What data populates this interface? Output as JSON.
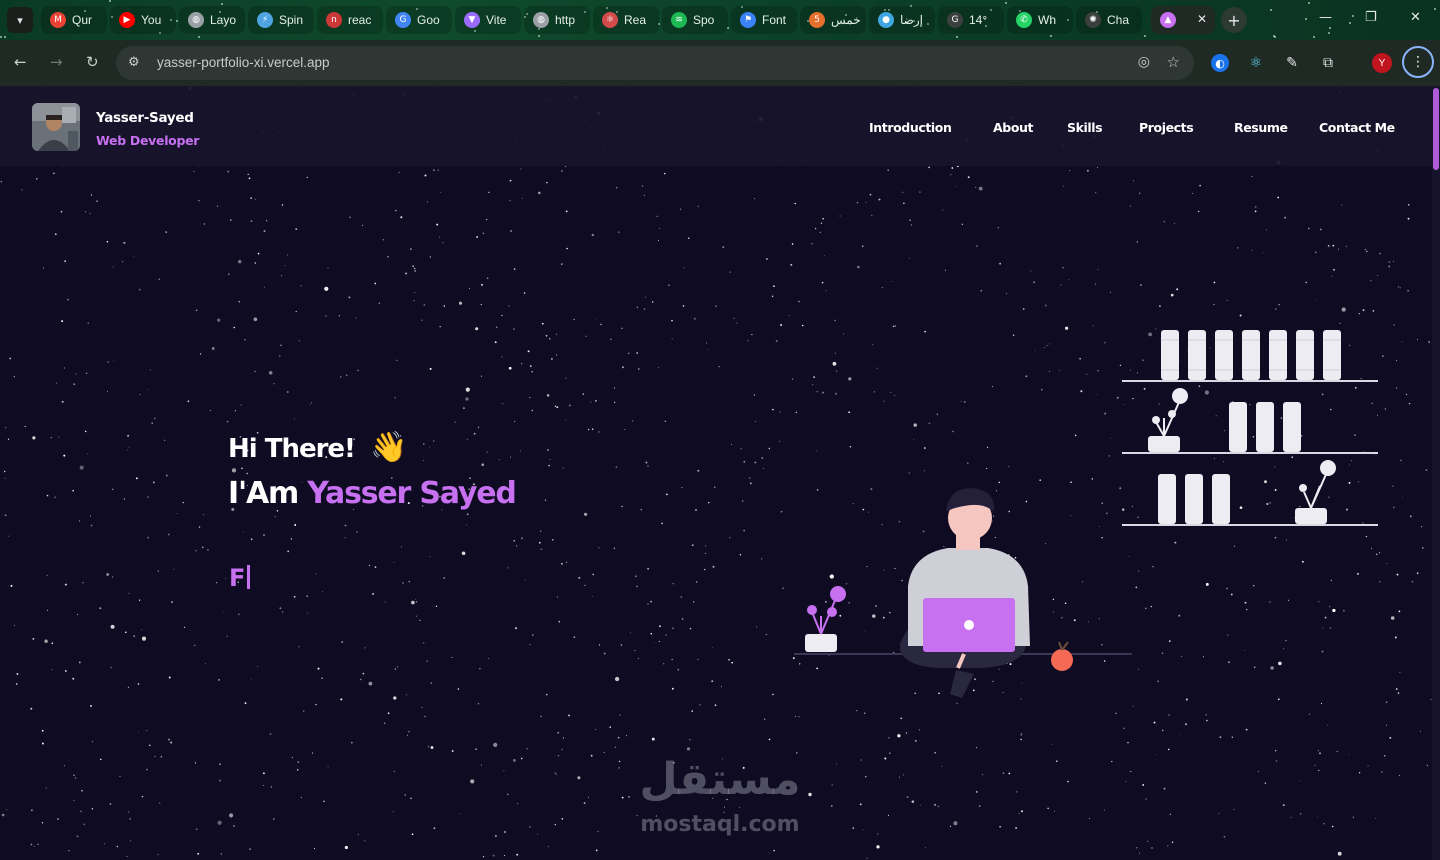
{
  "browser": {
    "tabs": [
      {
        "title": "Qur",
        "icon": "gmail-icon",
        "color": "#ea4335"
      },
      {
        "title": "You",
        "icon": "youtube-icon",
        "color": "#ff0000"
      },
      {
        "title": "Layo",
        "icon": "globe-icon",
        "color": "#9aa0a6"
      },
      {
        "title": "Spin",
        "icon": "spin-icon",
        "color": "#4fa3e0"
      },
      {
        "title": "reac",
        "icon": "npm-icon",
        "color": "#cb3837"
      },
      {
        "title": "Goo",
        "icon": "translate-icon",
        "color": "#4285f4"
      },
      {
        "title": "Vite",
        "icon": "vite-icon",
        "color": "#9b6bff"
      },
      {
        "title": "http",
        "icon": "globe-icon",
        "color": "#9aa0a6"
      },
      {
        "title": "Rea",
        "icon": "react-icon",
        "color": "#d34a4a"
      },
      {
        "title": "Spo",
        "icon": "spotify-icon",
        "color": "#1db954"
      },
      {
        "title": "Font",
        "icon": "flag-icon",
        "color": "#3b82f6"
      },
      {
        "title": "خمس",
        "icon": "html5-icon",
        "color": "#e76f2c"
      },
      {
        "title": "إرضا",
        "icon": "circle-icon",
        "color": "#3ea6e0"
      },
      {
        "title": "14°",
        "icon": "google-icon",
        "color": "#ffffff"
      },
      {
        "title": "Wh",
        "icon": "whatsapp-icon",
        "color": "#25d366"
      },
      {
        "title": "Cha",
        "icon": "openai-icon",
        "color": "#ffffff"
      },
      {
        "title": "",
        "icon": "portfolio-icon",
        "color": "#c770f0",
        "active": true
      }
    ],
    "url": "yasser-portfolio-xi.vercel.app",
    "profile_initial": "Y"
  },
  "site": {
    "brand": {
      "name": "Yasser-Sayed",
      "role": "Web Developer"
    },
    "nav": [
      "Introduction",
      "About",
      "Skills",
      "Projects",
      "Resume",
      "Contact Me"
    ],
    "hero": {
      "greeting": "Hi There!",
      "wave": "👋",
      "intro_prefix": "I'Am ",
      "intro_name": "Yasser Sayed",
      "typed": "F"
    },
    "accent": "#c770f0"
  },
  "watermark": {
    "arabic": "مستقل",
    "latin": "mostaql.com"
  }
}
